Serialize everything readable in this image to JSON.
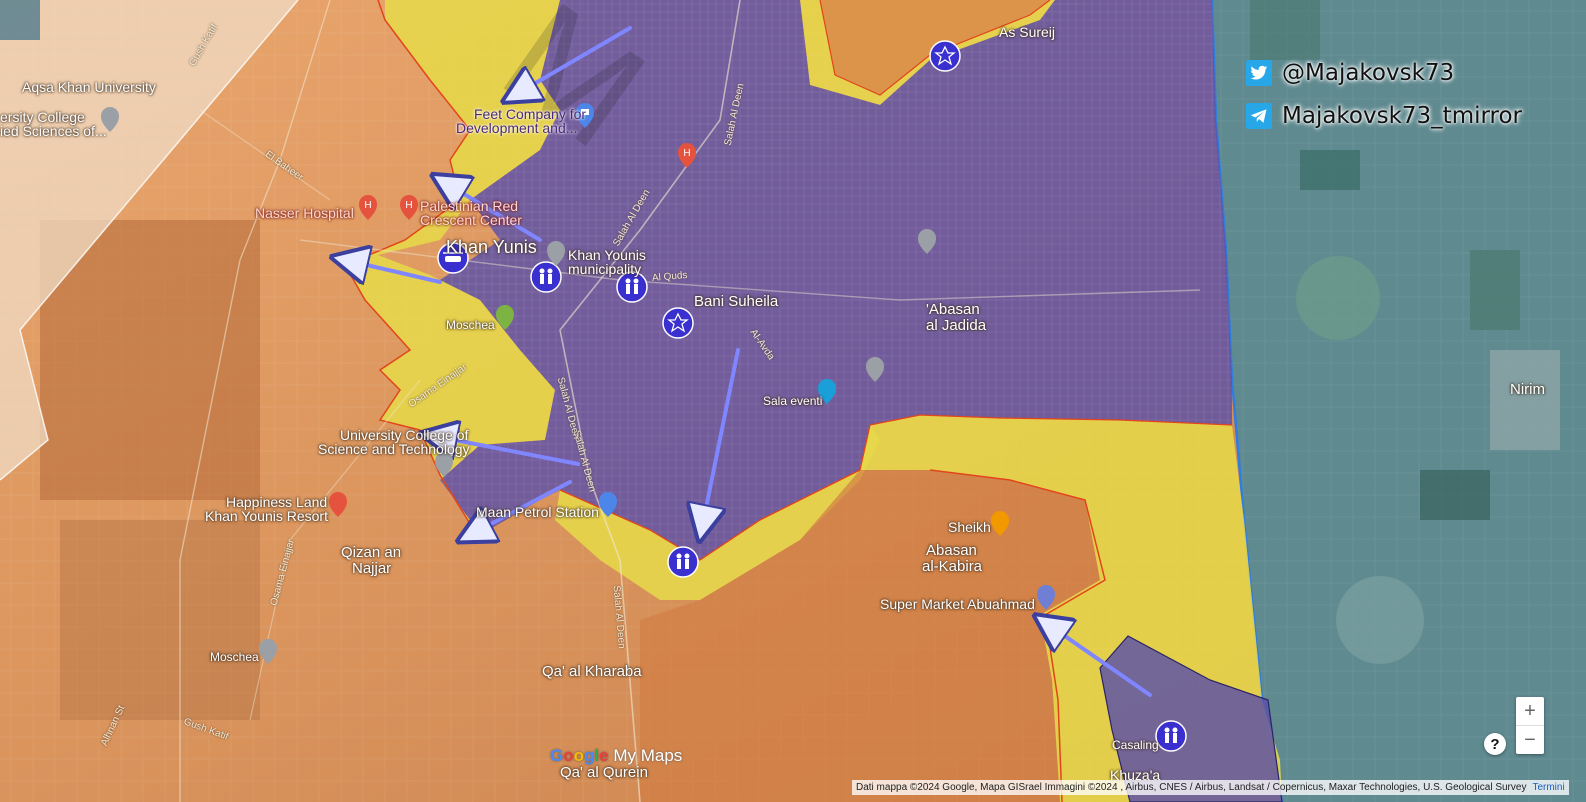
{
  "social": {
    "twitter_handle": "@Majakovsk73",
    "telegram_handle": "Majakovsk73_tmirror",
    "twitter_icon": "twitter-bird-icon",
    "telegram_icon": "telegram-plane-icon"
  },
  "places": {
    "aqsa_khan_university": "Aqsa Khan University",
    "university_college_sciences": "ied Sciences of...",
    "university_college_top": "ersity College",
    "nasser_hospital": "Nasser Hospital",
    "palestinian_red_crescent_1": "Palestinian Red",
    "palestinian_red_crescent_2": "Crescent Center",
    "khan_yunis": "Khan Yunis",
    "khan_yunis_municipality_1": "Khan Younis",
    "khan_yunis_municipality_2": "municipality",
    "bani_suheila": "Bani Suheila",
    "abasan_al_jadida_1": "'Abasan",
    "abasan_al_jadida_2": "al Jadida",
    "as_sureij": "As Sureij",
    "feet_company_1": "Feet Company for",
    "feet_company_2": "Development and...",
    "moschea_1": "Moschea",
    "moschea_2": "Moschea",
    "sala_eventi": "Sala eventi",
    "university_college_science_1": "University College of",
    "university_college_science_2": "Science and Technology",
    "happiness_land_1": "Happiness Land",
    "happiness_land_2": "Khan Younis Resort",
    "petrol_station": "Maan Petrol Station",
    "qizan_an_najjar_1": "Qizan an",
    "qizan_an_najjar_2": "Najjar",
    "sheikh": "Sheikh",
    "abasan_al_kabira_1": "Abasan",
    "abasan_al_kabira_2": "al-Kabira",
    "super_market": "Super Market Abuahmad",
    "qa_al_kharaba": "Qa' al Kharaba",
    "qa_al_qurein": "Qa' al Qurein",
    "nirim": "Nirim",
    "casaling": "Casaling",
    "khuzaa": "Khuza'a"
  },
  "roads": {
    "el_baheer": "El Baheer",
    "gush_katif_top": "Gush Katif",
    "salah_al_deen_1": "Salah Al Deen",
    "salah_al_deen_2": "Salah Al Deen",
    "salah_al_deen_3": "Salah Al Deen",
    "salah_al_deen_4": "Salah Al Deen",
    "salah_al_deen_5": "Salah Al Deen",
    "al_quds": "Al Quds",
    "al_avda": "Al-Avda",
    "osama_einajjar_1": "Osama Einajjar",
    "osama_einajjar_2": "Osama Einajjar",
    "gush_katif_bottom": "Gush Katif",
    "alhnan_st": "Alhnan St",
    "moschea_road": "Moschea"
  },
  "branding": {
    "google_g": "G",
    "google_o1": "o",
    "google_o2": "o",
    "google_g2": "g",
    "google_l": "l",
    "google_e": "e",
    "my_maps": "My Maps"
  },
  "attribution": {
    "text": "Dati mappa ©2024 Google, Mapa GISrael Immagini ©2024 , Airbus, CNES / Airbus, Landsat / Copernicus, Maxar Technologies, U.S. Geological Survey",
    "terms_link": "Termini"
  },
  "controls": {
    "zoom_in": "+",
    "zoom_out": "−",
    "help": "?"
  },
  "legend_colors": {
    "occupied_purple": "#5a4fa8",
    "contested_yellow": "#e6d84a",
    "held_orange": "#d9894a",
    "arrow": "#7f86ff",
    "border_blue": "#2f7de0"
  }
}
